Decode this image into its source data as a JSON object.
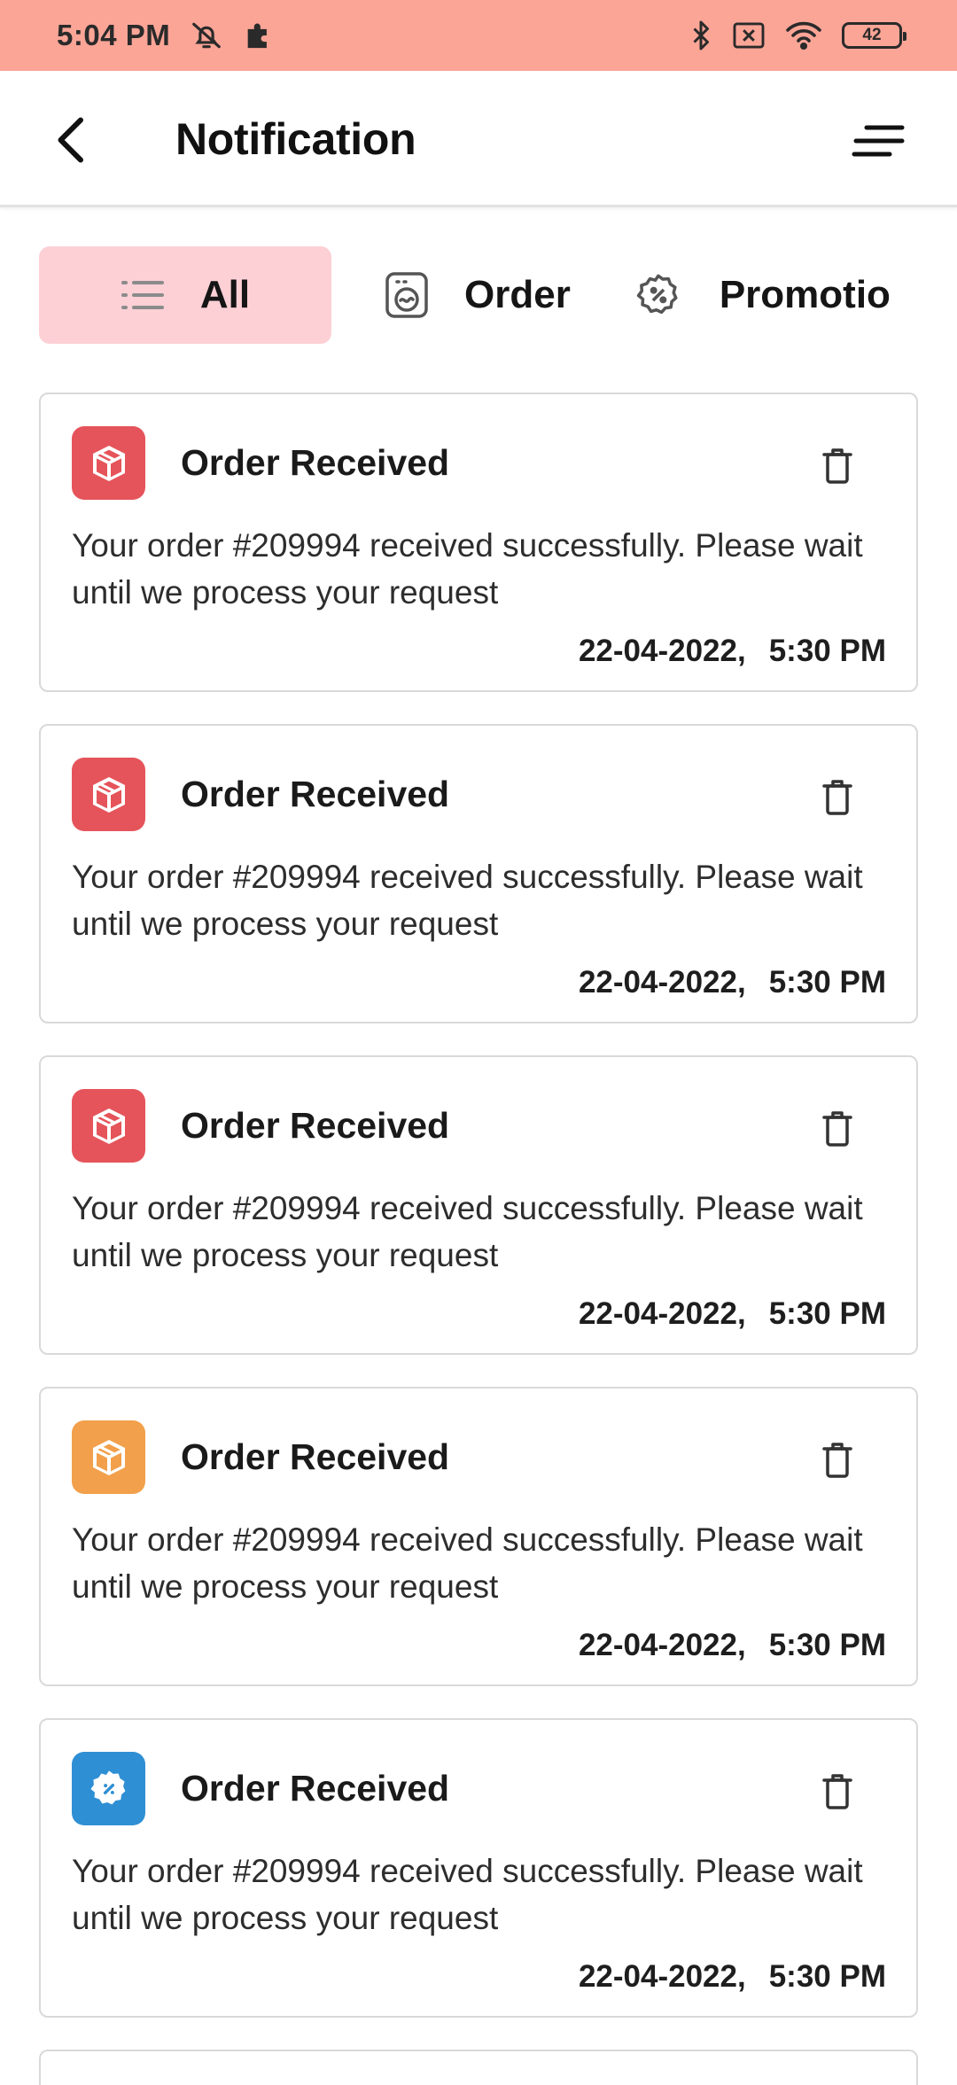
{
  "status_bar": {
    "time": "5:04 PM",
    "battery": "42",
    "icons": [
      "mute-bell-icon",
      "puzzle-icon",
      "bluetooth-icon",
      "sim-off-icon",
      "wifi-icon",
      "battery-icon"
    ]
  },
  "header": {
    "title": "Notification"
  },
  "tabs": [
    {
      "label": "All",
      "icon": "list-icon",
      "active": true
    },
    {
      "label": "Order",
      "icon": "order-icon",
      "active": false
    },
    {
      "label": "Promotio",
      "icon": "promotion-badge-icon",
      "active": false
    }
  ],
  "colors": {
    "status_bar": "#fba597",
    "active_tab": "#fdd0d6",
    "order_red": "#e5545a",
    "order_orange": "#f2a04b",
    "promo_blue": "#2f8fd4"
  },
  "notifications": [
    {
      "title": "Order Received",
      "message": "Your order #209994 received successfully. Please wait until we process your request",
      "date": "22-04-2022,",
      "time": "5:30 PM",
      "icon": "box-icon",
      "color": "#e5545a"
    },
    {
      "title": "Order Received",
      "message": "Your order #209994 received successfully. Please wait until we process your request",
      "date": "22-04-2022,",
      "time": "5:30 PM",
      "icon": "box-icon",
      "color": "#e5545a"
    },
    {
      "title": "Order Received",
      "message": "Your order #209994 received successfully. Please wait until we process your request",
      "date": "22-04-2022,",
      "time": "5:30 PM",
      "icon": "box-icon",
      "color": "#e5545a"
    },
    {
      "title": "Order Received",
      "message": "Your order #209994 received successfully. Please wait until we process your request",
      "date": "22-04-2022,",
      "time": "5:30 PM",
      "icon": "box-icon",
      "color": "#f2a04b"
    },
    {
      "title": "Order Received",
      "message": "Your order #209994 received successfully. Please wait until we process your request",
      "date": "22-04-2022,",
      "time": "5:30 PM",
      "icon": "promotion-badge-icon",
      "color": "#2f8fd4"
    }
  ]
}
